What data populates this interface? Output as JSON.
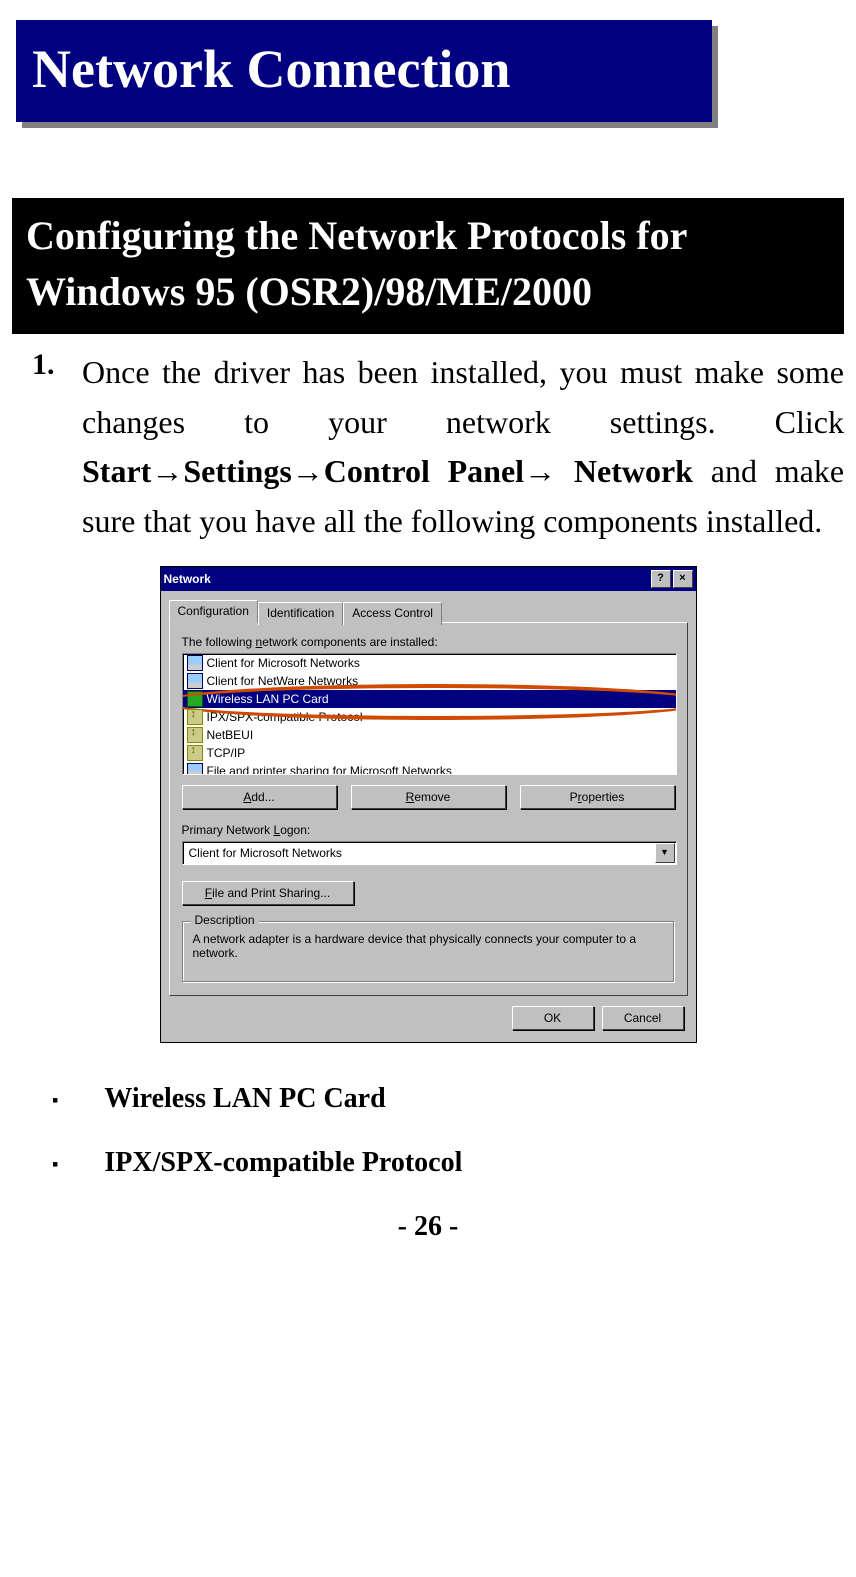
{
  "title": "Network Connection",
  "subtitle": "Configuring the Network Protocols for Windows 95 (OSR2)/98/ME/2000",
  "step": {
    "num": "1.",
    "text_a": "Once the driver has been installed, you must make some changes to your network settings. Click ",
    "path1": "Start",
    "path2": "Settings",
    "path3": "Control Panel",
    "path4": "Network",
    "text_b": " and make sure that you have all the following components installed.",
    "arrow": "→"
  },
  "dialog": {
    "title": "Network",
    "help_btn": "?",
    "close_btn": "×",
    "tabs": [
      "Configuration",
      "Identification",
      "Access Control"
    ],
    "list_label_pre": "The following ",
    "list_label_u": "n",
    "list_label_post": "etwork components are installed:",
    "components": [
      {
        "icon": "monitor",
        "label": "Client for Microsoft Networks"
      },
      {
        "icon": "monitor",
        "label": "Client for NetWare Networks"
      },
      {
        "icon": "adapter",
        "label": "Wireless LAN PC Card",
        "selected": true
      },
      {
        "icon": "proto",
        "label": "IPX/SPX-compatible Protocol"
      },
      {
        "icon": "proto",
        "label": "NetBEUI"
      },
      {
        "icon": "proto",
        "label": "TCP/IP"
      },
      {
        "icon": "share",
        "label": "File and printer sharing for Microsoft Networks"
      }
    ],
    "add_btn_u": "A",
    "add_btn_rest": "dd...",
    "remove_btn_u": "R",
    "remove_btn_rest": "emove",
    "props_btn_pre": "P",
    "props_btn_u": "r",
    "props_btn_rest": "operties",
    "logon_label_pre": "Primary Network ",
    "logon_label_u": "L",
    "logon_label_post": "ogon:",
    "logon_value": "Client for Microsoft Networks",
    "fps_btn_u": "F",
    "fps_btn_rest": "ile and Print Sharing...",
    "desc_label": "Description",
    "desc_text": "A network adapter is a hardware device that physically connects your computer to a network.",
    "ok": "OK",
    "cancel": "Cancel"
  },
  "bullets": [
    "Wireless LAN PC Card",
    "IPX/SPX-compatible Protocol"
  ],
  "page_number": "- 26 -"
}
